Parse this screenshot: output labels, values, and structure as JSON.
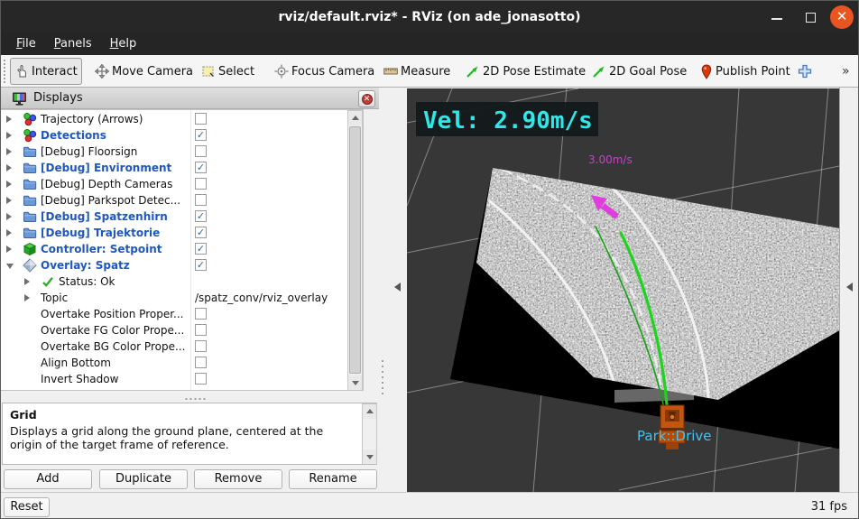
{
  "window": {
    "title": "rviz/default.rviz* - RViz (on ade_jonasotto)"
  },
  "menu": {
    "items": [
      "File",
      "Panels",
      "Help"
    ]
  },
  "toolbar": {
    "items": [
      {
        "icon": "hand-icon",
        "label": "Interact",
        "active": true
      },
      {
        "icon": "move-icon",
        "label": "Move Camera",
        "active": false
      },
      {
        "icon": "select-icon",
        "label": "Select",
        "active": false
      },
      {
        "icon": "focus-icon",
        "label": "Focus Camera",
        "active": false
      },
      {
        "icon": "measure-icon",
        "label": "Measure",
        "active": false
      },
      {
        "icon": "pose-arrow-icon",
        "label": "2D Pose Estimate",
        "active": false
      },
      {
        "icon": "pose-arrow-icon",
        "label": "2D Goal Pose",
        "active": false
      },
      {
        "icon": "pin-icon",
        "label": "Publish Point",
        "active": false
      },
      {
        "icon": "plus-icon",
        "label": "",
        "active": false
      },
      {
        "icon": "chevrons-icon",
        "label": "»",
        "active": false
      }
    ]
  },
  "displays_panel": {
    "title": "Displays",
    "rows": [
      {
        "arrow": "right",
        "icon": "balls",
        "label": "Trajectory (Arrows)",
        "bold": false,
        "checkbox": true,
        "checked": false
      },
      {
        "arrow": "right",
        "icon": "balls",
        "label": "Detections",
        "bold": true,
        "checkbox": true,
        "checked": true
      },
      {
        "arrow": "right",
        "icon": "folder",
        "label": "[Debug] Floorsign",
        "bold": false,
        "checkbox": true,
        "checked": false
      },
      {
        "arrow": "right",
        "icon": "folder",
        "label": "[Debug] Environment",
        "bold": true,
        "checkbox": true,
        "checked": true
      },
      {
        "arrow": "right",
        "icon": "folder",
        "label": "[Debug] Depth Cameras",
        "bold": false,
        "checkbox": true,
        "checked": false
      },
      {
        "arrow": "right",
        "icon": "folder",
        "label": "[Debug] Parkspot Detec...",
        "bold": false,
        "checkbox": true,
        "checked": false
      },
      {
        "arrow": "right",
        "icon": "folder",
        "label": "[Debug] Spatzenhirn",
        "bold": true,
        "checkbox": true,
        "checked": true
      },
      {
        "arrow": "right",
        "icon": "folder",
        "label": "[Debug] Trajektorie",
        "bold": true,
        "checkbox": true,
        "checked": true
      },
      {
        "arrow": "right",
        "icon": "cube",
        "label": "Controller: Setpoint",
        "bold": true,
        "checkbox": true,
        "checked": true
      },
      {
        "arrow": "down",
        "icon": "diamond",
        "label": "Overlay: Spatz",
        "bold": true,
        "checkbox": true,
        "checked": true
      },
      {
        "arrow": "right",
        "indent": 1,
        "icon": "check",
        "label": "Status: Ok"
      },
      {
        "arrow": "right",
        "indent": 1,
        "label": "Topic",
        "value": "/spatz_conv/rviz_overlay"
      },
      {
        "indent": 1,
        "label": "Overtake Position Proper...",
        "checkbox": true,
        "checked": false
      },
      {
        "indent": 1,
        "label": "Overtake FG Color Prope...",
        "checkbox": true,
        "checked": false
      },
      {
        "indent": 1,
        "label": "Overtake BG Color Prope...",
        "checkbox": true,
        "checked": false
      },
      {
        "indent": 1,
        "label": "Align Bottom",
        "checkbox": true,
        "checked": false
      },
      {
        "indent": 1,
        "label": "Invert Shadow",
        "checkbox": true,
        "checked": false
      }
    ]
  },
  "help": {
    "title": "Grid",
    "description": "Displays a grid along the ground plane, centered at the origin of the target frame of reference."
  },
  "buttons": [
    "Add",
    "Duplicate",
    "Remove",
    "Rename"
  ],
  "reset_label": "Reset",
  "status": {
    "fps": "31 fps"
  },
  "view3d": {
    "vel_overlay": "Vel: 2.90m/s",
    "speed_label": "3.00m/s",
    "state_label": "Park::Drive"
  },
  "colors": {
    "titlebar_close": "#E95420",
    "enabled_display_text": "#2058b8",
    "vel_text": "#30e6e6",
    "speed_label_text": "#c840c8",
    "state_label_text": "#41c4f1",
    "trajectory_green": "#1dd41d",
    "arrow_magenta": "#e03ce0",
    "robot_orange": "#c2560e"
  }
}
